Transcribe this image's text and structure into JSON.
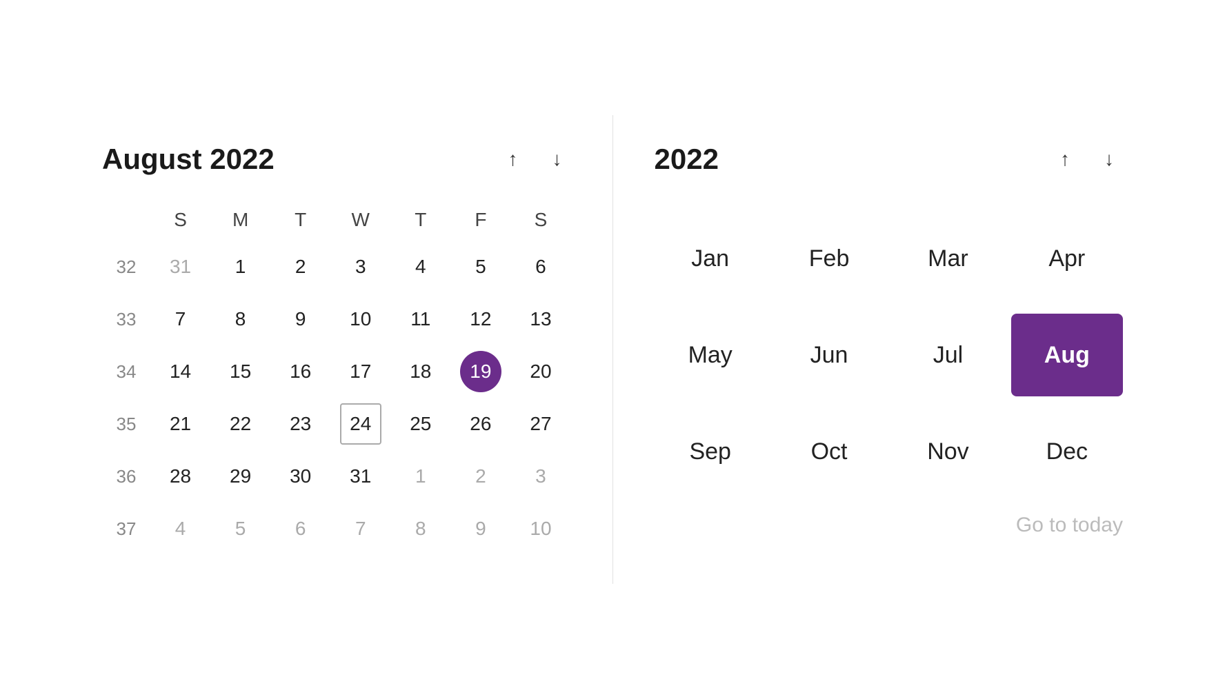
{
  "left": {
    "title": "August 2022",
    "nav_up_label": "↑",
    "nav_down_label": "↓",
    "days_of_week": [
      "S",
      "M",
      "T",
      "W",
      "T",
      "F",
      "S"
    ],
    "weeks": [
      {
        "week_num": "32",
        "days": [
          {
            "num": "31",
            "state": "other-month"
          },
          {
            "num": "1",
            "state": ""
          },
          {
            "num": "2",
            "state": ""
          },
          {
            "num": "3",
            "state": ""
          },
          {
            "num": "4",
            "state": ""
          },
          {
            "num": "5",
            "state": ""
          },
          {
            "num": "6",
            "state": ""
          }
        ]
      },
      {
        "week_num": "33",
        "days": [
          {
            "num": "7",
            "state": ""
          },
          {
            "num": "8",
            "state": ""
          },
          {
            "num": "9",
            "state": ""
          },
          {
            "num": "10",
            "state": ""
          },
          {
            "num": "11",
            "state": ""
          },
          {
            "num": "12",
            "state": ""
          },
          {
            "num": "13",
            "state": ""
          }
        ]
      },
      {
        "week_num": "34",
        "days": [
          {
            "num": "14",
            "state": ""
          },
          {
            "num": "15",
            "state": ""
          },
          {
            "num": "16",
            "state": ""
          },
          {
            "num": "17",
            "state": ""
          },
          {
            "num": "18",
            "state": ""
          },
          {
            "num": "19",
            "state": "selected"
          },
          {
            "num": "20",
            "state": ""
          }
        ]
      },
      {
        "week_num": "35",
        "days": [
          {
            "num": "21",
            "state": ""
          },
          {
            "num": "22",
            "state": ""
          },
          {
            "num": "23",
            "state": ""
          },
          {
            "num": "24",
            "state": "today-outlined"
          },
          {
            "num": "25",
            "state": ""
          },
          {
            "num": "26",
            "state": ""
          },
          {
            "num": "27",
            "state": ""
          }
        ]
      },
      {
        "week_num": "36",
        "days": [
          {
            "num": "28",
            "state": ""
          },
          {
            "num": "29",
            "state": ""
          },
          {
            "num": "30",
            "state": ""
          },
          {
            "num": "31",
            "state": ""
          },
          {
            "num": "1",
            "state": "other-month"
          },
          {
            "num": "2",
            "state": "other-month"
          },
          {
            "num": "3",
            "state": "other-month"
          }
        ]
      },
      {
        "week_num": "37",
        "days": [
          {
            "num": "4",
            "state": "other-month"
          },
          {
            "num": "5",
            "state": "other-month"
          },
          {
            "num": "6",
            "state": "other-month"
          },
          {
            "num": "7",
            "state": "other-month"
          },
          {
            "num": "8",
            "state": "other-month"
          },
          {
            "num": "9",
            "state": "other-month"
          },
          {
            "num": "10",
            "state": "other-month"
          }
        ]
      }
    ]
  },
  "right": {
    "title": "2022",
    "nav_up_label": "↑",
    "nav_down_label": "↓",
    "months": [
      {
        "label": "Jan",
        "active": false
      },
      {
        "label": "Feb",
        "active": false
      },
      {
        "label": "Mar",
        "active": false
      },
      {
        "label": "Apr",
        "active": false
      },
      {
        "label": "May",
        "active": false
      },
      {
        "label": "Jun",
        "active": false
      },
      {
        "label": "Jul",
        "active": false
      },
      {
        "label": "Aug",
        "active": true
      },
      {
        "label": "Sep",
        "active": false
      },
      {
        "label": "Oct",
        "active": false
      },
      {
        "label": "Nov",
        "active": false
      },
      {
        "label": "Dec",
        "active": false
      }
    ],
    "go_to_today": "Go to today"
  }
}
